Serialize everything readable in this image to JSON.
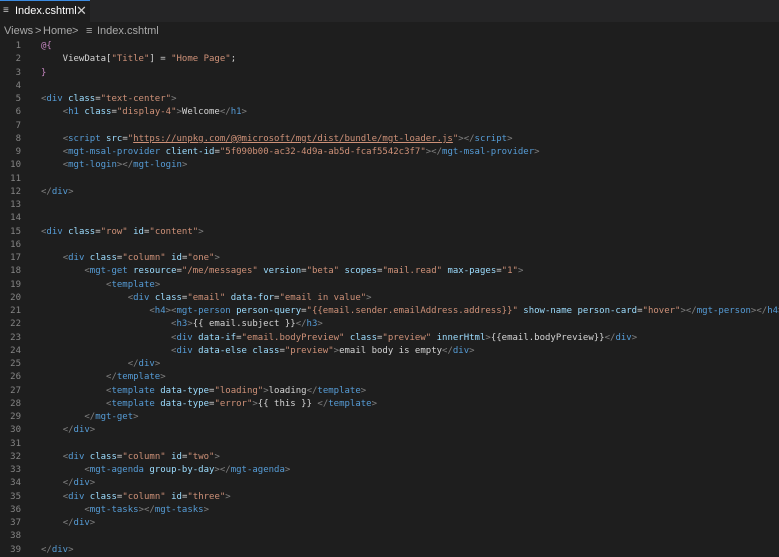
{
  "tab": {
    "icon": "≡",
    "label": "Index.cshtml",
    "close": "✕"
  },
  "breadcrumb": [
    {
      "label": "Views"
    },
    {
      "label": ">"
    },
    {
      "label": "Home"
    },
    {
      "label": ">"
    },
    {
      "label": "≡"
    },
    {
      "label": "Index.cshtml"
    }
  ],
  "lines": [
    {
      "num": "1",
      "tokens": [
        [
          "razor",
          "@{"
        ]
      ]
    },
    {
      "num": "2",
      "tokens": [
        [
          "text",
          "    ViewData["
        ],
        [
          "str",
          "\"Title\""
        ],
        [
          "text",
          "] = "
        ],
        [
          "str",
          "\"Home Page\""
        ],
        [
          "text",
          ";"
        ]
      ]
    },
    {
      "num": "3",
      "tokens": [
        [
          "razor",
          "}"
        ]
      ]
    },
    {
      "num": "4",
      "tokens": []
    },
    {
      "num": "5",
      "tokens": [
        [
          "punc",
          "<"
        ],
        [
          "tag",
          "div"
        ],
        [
          "text",
          " "
        ],
        [
          "attr",
          "class"
        ],
        [
          "text",
          "="
        ],
        [
          "str",
          "\"text-center\""
        ],
        [
          "punc",
          ">"
        ]
      ]
    },
    {
      "num": "6",
      "tokens": [
        [
          "text",
          "    "
        ],
        [
          "punc",
          "<"
        ],
        [
          "tag",
          "h1"
        ],
        [
          "text",
          " "
        ],
        [
          "attr",
          "class"
        ],
        [
          "text",
          "="
        ],
        [
          "str",
          "\"display-4\""
        ],
        [
          "punc",
          ">"
        ],
        [
          "text",
          "Welcome"
        ],
        [
          "punc",
          "</"
        ],
        [
          "tag",
          "h1"
        ],
        [
          "punc",
          ">"
        ]
      ]
    },
    {
      "num": "7",
      "tokens": []
    },
    {
      "num": "8",
      "tokens": [
        [
          "text",
          "    "
        ],
        [
          "punc",
          "<"
        ],
        [
          "tag",
          "script"
        ],
        [
          "text",
          " "
        ],
        [
          "attr",
          "src"
        ],
        [
          "text",
          "="
        ],
        [
          "str",
          "\""
        ],
        [
          "link",
          "https://unpkg.com/@@microsoft/mgt/dist/bundle/mgt-loader.js"
        ],
        [
          "str",
          "\""
        ],
        [
          "punc",
          "></"
        ],
        [
          "tag",
          "script"
        ],
        [
          "punc",
          ">"
        ]
      ]
    },
    {
      "num": "9",
      "tokens": [
        [
          "text",
          "    "
        ],
        [
          "punc",
          "<"
        ],
        [
          "tag",
          "mgt-msal-provider"
        ],
        [
          "text",
          " "
        ],
        [
          "attr",
          "client-id"
        ],
        [
          "text",
          "="
        ],
        [
          "str",
          "\"5f090b00-ac32-4d9a-ab5d-fcaf5542c3f7\""
        ],
        [
          "punc",
          "></"
        ],
        [
          "tag",
          "mgt-msal-provider"
        ],
        [
          "punc",
          ">"
        ]
      ]
    },
    {
      "num": "10",
      "tokens": [
        [
          "text",
          "    "
        ],
        [
          "punc",
          "<"
        ],
        [
          "tag",
          "mgt-login"
        ],
        [
          "punc",
          "></"
        ],
        [
          "tag",
          "mgt-login"
        ],
        [
          "punc",
          ">"
        ]
      ]
    },
    {
      "num": "11",
      "tokens": []
    },
    {
      "num": "12",
      "tokens": [
        [
          "punc",
          "</"
        ],
        [
          "tag",
          "div"
        ],
        [
          "punc",
          ">"
        ]
      ]
    },
    {
      "num": "13",
      "tokens": []
    },
    {
      "num": "14",
      "tokens": []
    },
    {
      "num": "15",
      "tokens": [
        [
          "punc",
          "<"
        ],
        [
          "tag",
          "div"
        ],
        [
          "text",
          " "
        ],
        [
          "attr",
          "class"
        ],
        [
          "text",
          "="
        ],
        [
          "str",
          "\"row\""
        ],
        [
          "text",
          " "
        ],
        [
          "attr",
          "id"
        ],
        [
          "text",
          "="
        ],
        [
          "str",
          "\"content\""
        ],
        [
          "punc",
          ">"
        ]
      ]
    },
    {
      "num": "16",
      "tokens": []
    },
    {
      "num": "17",
      "tokens": [
        [
          "text",
          "    "
        ],
        [
          "punc",
          "<"
        ],
        [
          "tag",
          "div"
        ],
        [
          "text",
          " "
        ],
        [
          "attr",
          "class"
        ],
        [
          "text",
          "="
        ],
        [
          "str",
          "\"column\""
        ],
        [
          "text",
          " "
        ],
        [
          "attr",
          "id"
        ],
        [
          "text",
          "="
        ],
        [
          "str",
          "\"one\""
        ],
        [
          "punc",
          ">"
        ]
      ]
    },
    {
      "num": "18",
      "tokens": [
        [
          "text",
          "        "
        ],
        [
          "punc",
          "<"
        ],
        [
          "tag",
          "mgt-get"
        ],
        [
          "text",
          " "
        ],
        [
          "attr",
          "resource"
        ],
        [
          "text",
          "="
        ],
        [
          "str",
          "\"/me/messages\""
        ],
        [
          "text",
          " "
        ],
        [
          "attr",
          "version"
        ],
        [
          "text",
          "="
        ],
        [
          "str",
          "\"beta\""
        ],
        [
          "text",
          " "
        ],
        [
          "attr",
          "scopes"
        ],
        [
          "text",
          "="
        ],
        [
          "str",
          "\"mail.read\""
        ],
        [
          "text",
          " "
        ],
        [
          "attr",
          "max-pages"
        ],
        [
          "text",
          "="
        ],
        [
          "str",
          "\"1\""
        ],
        [
          "punc",
          ">"
        ]
      ]
    },
    {
      "num": "19",
      "tokens": [
        [
          "text",
          "            "
        ],
        [
          "punc",
          "<"
        ],
        [
          "tag",
          "template"
        ],
        [
          "punc",
          ">"
        ]
      ]
    },
    {
      "num": "20",
      "tokens": [
        [
          "text",
          "                "
        ],
        [
          "punc",
          "<"
        ],
        [
          "tag",
          "div"
        ],
        [
          "text",
          " "
        ],
        [
          "attr",
          "class"
        ],
        [
          "text",
          "="
        ],
        [
          "str",
          "\"email\""
        ],
        [
          "text",
          " "
        ],
        [
          "attr",
          "data-for"
        ],
        [
          "text",
          "="
        ],
        [
          "str",
          "\"email in value\""
        ],
        [
          "punc",
          ">"
        ]
      ]
    },
    {
      "num": "21",
      "tokens": [
        [
          "text",
          "                    "
        ],
        [
          "punc",
          "<"
        ],
        [
          "tag",
          "h4"
        ],
        [
          "punc",
          "><"
        ],
        [
          "tag",
          "mgt-person"
        ],
        [
          "text",
          " "
        ],
        [
          "attr",
          "person-query"
        ],
        [
          "text",
          "="
        ],
        [
          "str",
          "\"{{email.sender.emailAddress.address}}\""
        ],
        [
          "text",
          " "
        ],
        [
          "attr",
          "show-name"
        ],
        [
          "text",
          " "
        ],
        [
          "attr",
          "person-card"
        ],
        [
          "text",
          "="
        ],
        [
          "str",
          "\"hover\""
        ],
        [
          "punc",
          "></"
        ],
        [
          "tag",
          "mgt-person"
        ],
        [
          "punc",
          "></"
        ],
        [
          "tag",
          "h4"
        ],
        [
          "punc",
          ">"
        ]
      ]
    },
    {
      "num": "22",
      "tokens": [
        [
          "text",
          "                        "
        ],
        [
          "punc",
          "<"
        ],
        [
          "tag",
          "h3"
        ],
        [
          "punc",
          ">"
        ],
        [
          "text",
          "{{ email.subject }}"
        ],
        [
          "punc",
          "</"
        ],
        [
          "tag",
          "h3"
        ],
        [
          "punc",
          ">"
        ]
      ]
    },
    {
      "num": "23",
      "tokens": [
        [
          "text",
          "                        "
        ],
        [
          "punc",
          "<"
        ],
        [
          "tag",
          "div"
        ],
        [
          "text",
          " "
        ],
        [
          "attr",
          "data-if"
        ],
        [
          "text",
          "="
        ],
        [
          "str",
          "\"email.bodyPreview\""
        ],
        [
          "text",
          " "
        ],
        [
          "attr",
          "class"
        ],
        [
          "text",
          "="
        ],
        [
          "str",
          "\"preview\""
        ],
        [
          "text",
          " "
        ],
        [
          "attr",
          "innerHtml"
        ],
        [
          "punc",
          ">"
        ],
        [
          "text",
          "{{email.bodyPreview}}"
        ],
        [
          "punc",
          "</"
        ],
        [
          "tag",
          "div"
        ],
        [
          "punc",
          ">"
        ]
      ]
    },
    {
      "num": "24",
      "tokens": [
        [
          "text",
          "                        "
        ],
        [
          "punc",
          "<"
        ],
        [
          "tag",
          "div"
        ],
        [
          "text",
          " "
        ],
        [
          "attr",
          "data-else"
        ],
        [
          "text",
          " "
        ],
        [
          "attr",
          "class"
        ],
        [
          "text",
          "="
        ],
        [
          "str",
          "\"preview\""
        ],
        [
          "punc",
          ">"
        ],
        [
          "text",
          "email body is empty"
        ],
        [
          "punc",
          "</"
        ],
        [
          "tag",
          "div"
        ],
        [
          "punc",
          ">"
        ]
      ]
    },
    {
      "num": "25",
      "tokens": [
        [
          "text",
          "                "
        ],
        [
          "punc",
          "</"
        ],
        [
          "tag",
          "div"
        ],
        [
          "punc",
          ">"
        ]
      ]
    },
    {
      "num": "26",
      "tokens": [
        [
          "text",
          "            "
        ],
        [
          "punc",
          "</"
        ],
        [
          "tag",
          "template"
        ],
        [
          "punc",
          ">"
        ]
      ]
    },
    {
      "num": "27",
      "tokens": [
        [
          "text",
          "            "
        ],
        [
          "punc",
          "<"
        ],
        [
          "tag",
          "template"
        ],
        [
          "text",
          " "
        ],
        [
          "attr",
          "data-type"
        ],
        [
          "text",
          "="
        ],
        [
          "str",
          "\"loading\""
        ],
        [
          "punc",
          ">"
        ],
        [
          "text",
          "loading"
        ],
        [
          "punc",
          "</"
        ],
        [
          "tag",
          "template"
        ],
        [
          "punc",
          ">"
        ]
      ]
    },
    {
      "num": "28",
      "tokens": [
        [
          "text",
          "            "
        ],
        [
          "punc",
          "<"
        ],
        [
          "tag",
          "template"
        ],
        [
          "text",
          " "
        ],
        [
          "attr",
          "data-type"
        ],
        [
          "text",
          "="
        ],
        [
          "str",
          "\"error\""
        ],
        [
          "punc",
          ">"
        ],
        [
          "text",
          "{{ this }} "
        ],
        [
          "punc",
          "</"
        ],
        [
          "tag",
          "template"
        ],
        [
          "punc",
          ">"
        ]
      ]
    },
    {
      "num": "29",
      "tokens": [
        [
          "text",
          "        "
        ],
        [
          "punc",
          "</"
        ],
        [
          "tag",
          "mgt-get"
        ],
        [
          "punc",
          ">"
        ]
      ]
    },
    {
      "num": "30",
      "tokens": [
        [
          "text",
          "    "
        ],
        [
          "punc",
          "</"
        ],
        [
          "tag",
          "div"
        ],
        [
          "punc",
          ">"
        ]
      ]
    },
    {
      "num": "31",
      "tokens": []
    },
    {
      "num": "32",
      "tokens": [
        [
          "text",
          "    "
        ],
        [
          "punc",
          "<"
        ],
        [
          "tag",
          "div"
        ],
        [
          "text",
          " "
        ],
        [
          "attr",
          "class"
        ],
        [
          "text",
          "="
        ],
        [
          "str",
          "\"column\""
        ],
        [
          "text",
          " "
        ],
        [
          "attr",
          "id"
        ],
        [
          "text",
          "="
        ],
        [
          "str",
          "\"two\""
        ],
        [
          "punc",
          ">"
        ]
      ]
    },
    {
      "num": "33",
      "tokens": [
        [
          "text",
          "        "
        ],
        [
          "punc",
          "<"
        ],
        [
          "tag",
          "mgt-agenda"
        ],
        [
          "text",
          " "
        ],
        [
          "attr",
          "group-by-day"
        ],
        [
          "punc",
          "></"
        ],
        [
          "tag",
          "mgt-agenda"
        ],
        [
          "punc",
          ">"
        ]
      ]
    },
    {
      "num": "34",
      "tokens": [
        [
          "text",
          "    "
        ],
        [
          "punc",
          "</"
        ],
        [
          "tag",
          "div"
        ],
        [
          "punc",
          ">"
        ]
      ]
    },
    {
      "num": "35",
      "tokens": [
        [
          "text",
          "    "
        ],
        [
          "punc",
          "<"
        ],
        [
          "tag",
          "div"
        ],
        [
          "text",
          " "
        ],
        [
          "attr",
          "class"
        ],
        [
          "text",
          "="
        ],
        [
          "str",
          "\"column\""
        ],
        [
          "text",
          " "
        ],
        [
          "attr",
          "id"
        ],
        [
          "text",
          "="
        ],
        [
          "str",
          "\"three\""
        ],
        [
          "punc",
          ">"
        ]
      ]
    },
    {
      "num": "36",
      "tokens": [
        [
          "text",
          "        "
        ],
        [
          "punc",
          "<"
        ],
        [
          "tag",
          "mgt-tasks"
        ],
        [
          "punc",
          "></"
        ],
        [
          "tag",
          "mgt-tasks"
        ],
        [
          "punc",
          ">"
        ]
      ]
    },
    {
      "num": "37",
      "tokens": [
        [
          "text",
          "    "
        ],
        [
          "punc",
          "</"
        ],
        [
          "tag",
          "div"
        ],
        [
          "punc",
          ">"
        ]
      ]
    },
    {
      "num": "38",
      "tokens": []
    },
    {
      "num": "39",
      "tokens": [
        [
          "punc",
          "</"
        ],
        [
          "tag",
          "div"
        ],
        [
          "punc",
          ">"
        ]
      ]
    }
  ]
}
